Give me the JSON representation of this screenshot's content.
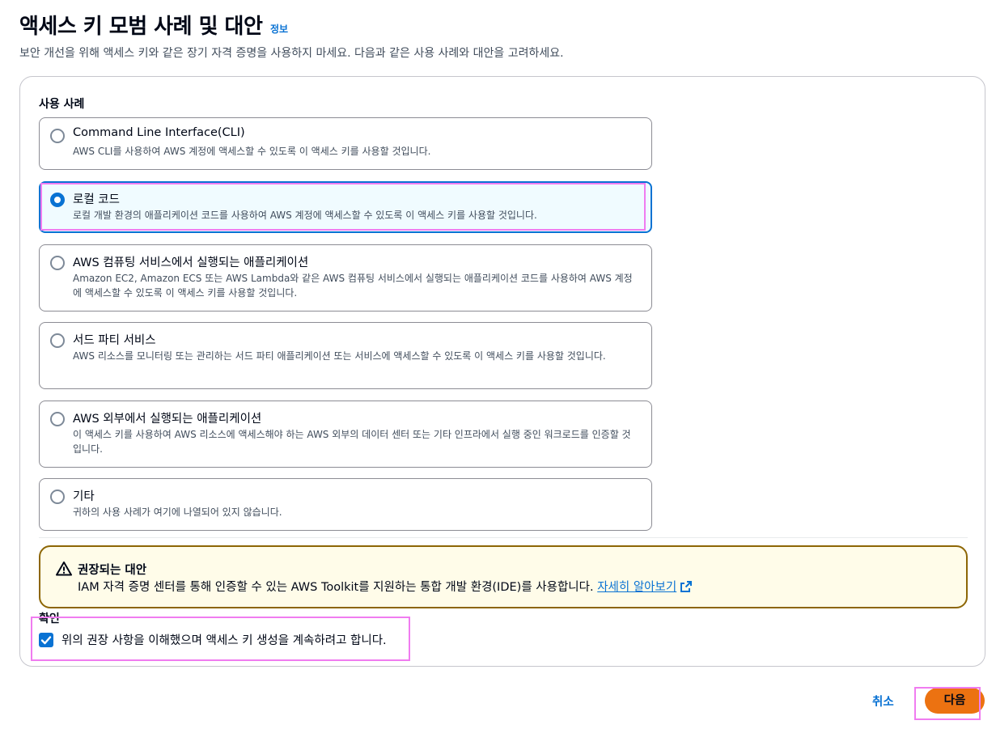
{
  "header": {
    "title": "액세스 키 모범 사례 및 대안",
    "info_link": "정보",
    "description": "보안 개선을 위해 액세스 키와 같은 장기 자격 증명을 사용하지 마세요. 다음과 같은 사용 사례와 대안을 고려하세요."
  },
  "use_cases": {
    "label": "사용 사례",
    "selected_index": 1,
    "options": [
      {
        "title": "Command Line Interface(CLI)",
        "description": "AWS CLI를 사용하여 AWS 계정에 액세스할 수 있도록 이 액세스 키를 사용할 것입니다."
      },
      {
        "title": "로컬 코드",
        "description": "로컬 개발 환경의 애플리케이션 코드를 사용하여 AWS 계정에 액세스할 수 있도록 이 액세스 키를 사용할 것입니다."
      },
      {
        "title": "AWS 컴퓨팅 서비스에서 실행되는 애플리케이션",
        "description": "Amazon EC2, Amazon ECS 또는 AWS Lambda와 같은 AWS 컴퓨팅 서비스에서 실행되는 애플리케이션 코드를 사용하여 AWS 계정에 액세스할 수 있도록 이 액세스 키를 사용할 것입니다."
      },
      {
        "title": "서드 파티 서비스",
        "description": "AWS 리소스를 모니터링 또는 관리하는 서드 파티 애플리케이션 또는 서비스에 액세스할 수 있도록 이 액세스 키를 사용할 것입니다."
      },
      {
        "title": "AWS 외부에서 실행되는 애플리케이션",
        "description": "이 액세스 키를 사용하여 AWS 리소스에 액세스해야 하는 AWS 외부의 데이터 센터 또는 기타 인프라에서 실행 중인 워크로드를 인증할 것입니다."
      },
      {
        "title": "기타",
        "description": "귀하의 사용 사례가 여기에 나열되어 있지 않습니다."
      }
    ]
  },
  "alert": {
    "icon": "warning-icon",
    "title": "권장되는 대안",
    "text": "IAM 자격 증명 센터를 통해 인증할 수 있는 AWS Toolkit를 지원하는 통합 개발 환경(IDE)를 사용합니다.",
    "link": "자세히 알아보기",
    "link_icon": "external-link-icon"
  },
  "confirmation": {
    "label": "확인",
    "checked": true,
    "checkbox_text": "위의 권장 사항을 이해했으며 액세스 키 생성을 계속하려고 합니다."
  },
  "footer": {
    "cancel": "취소",
    "next": "다음"
  },
  "colors": {
    "accent": "#0972d3",
    "primary_button": "#ec7211",
    "warning_border": "#8d6605",
    "highlight": "#f07cf0"
  }
}
